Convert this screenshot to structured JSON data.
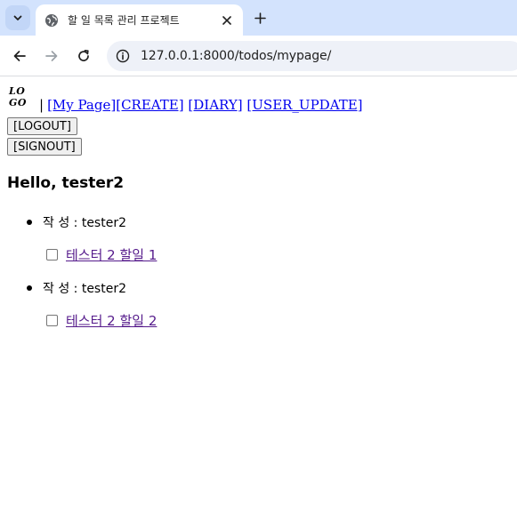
{
  "browser": {
    "tab_title": "할 일 목록 관리 프로젝트",
    "url": "127.0.0.1:8000/todos/mypage/"
  },
  "header": {
    "logo_text": "LO GO",
    "separator": "|",
    "nav": {
      "mypage": "[My Page]",
      "create": "[CREATE]",
      "diary": "[DIARY]",
      "user_update": "[USER_UPDATE]"
    },
    "logout_label": "[LOGOUT]",
    "signout_label": "[SIGNOUT]"
  },
  "main": {
    "greeting": "Hello, tester2",
    "entries": [
      {
        "author_text": "작 성 : tester2",
        "todo_title": "테스터 2 할일 1",
        "checked": false
      },
      {
        "author_text": "작 성 : tester2",
        "todo_title": "테스터 2 할일 2",
        "checked": false
      }
    ]
  }
}
